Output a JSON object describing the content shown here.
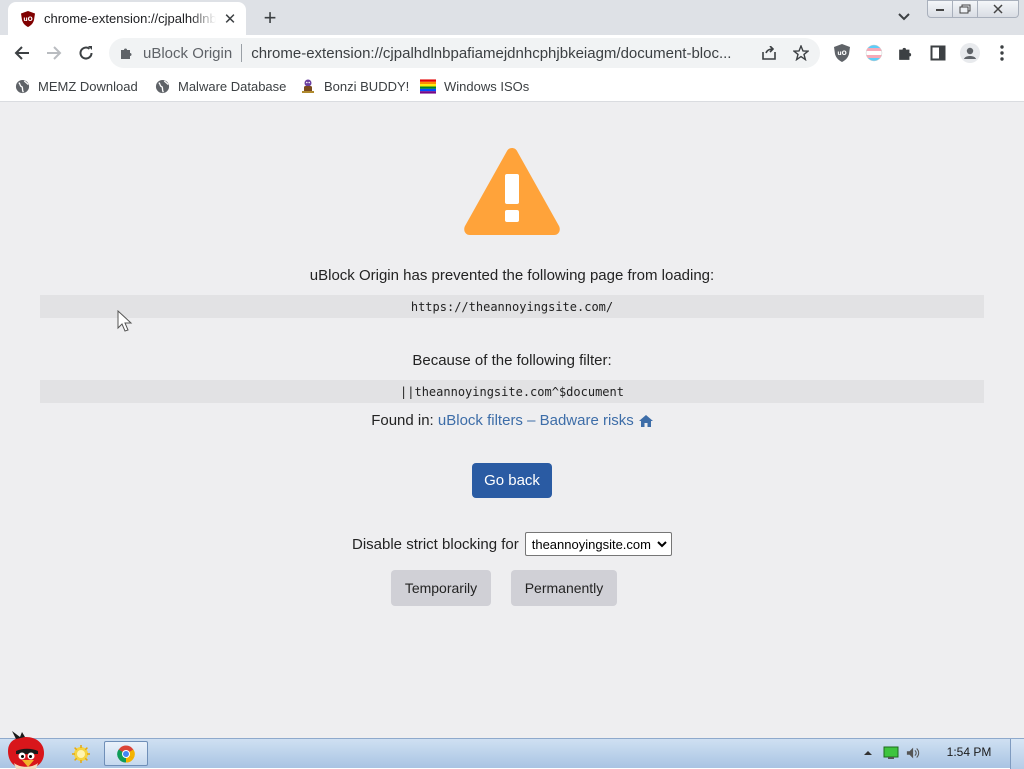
{
  "browser": {
    "tab": {
      "title": "chrome-extension://cjpalhdlnbpafiamejdnhcphjbkeiagm/document-blocked.html",
      "favicon": "ublock-origin-icon",
      "close_glyph": "✕"
    },
    "new_tab_glyph": "+",
    "omnibox": {
      "site_name": "uBlock Origin",
      "url": "chrome-extension://cjpalhdlnbpafiamejdnhcphjbkeiagm/document-bloc..."
    },
    "bookmarks": [
      {
        "label": "MEMZ Download",
        "icon": "globe-icon"
      },
      {
        "label": "Malware Database",
        "icon": "globe-icon"
      },
      {
        "label": "Bonzi BUDDY!",
        "icon": "bonzi-icon"
      },
      {
        "label": "Windows ISOs",
        "icon": "windows-flag-icon"
      }
    ]
  },
  "page": {
    "message": "uBlock Origin has prevented the following page from loading:",
    "blocked_url": "https://theannoyingsite.com/",
    "filter_message": "Because of the following filter:",
    "filter": "||theannoyingsite.com^$document",
    "found_in_label": "Found in:",
    "found_in_list": "uBlock filters – Badware risks",
    "go_back": "Go back",
    "strict_label": "Disable strict blocking for",
    "strict_domain": "theannoyingsite.com",
    "temporarily": "Temporarily",
    "permanently": "Permanently",
    "colors": {
      "warning": "#ffa33a",
      "primary_button": "#2a5ba3",
      "link": "#3d6da8",
      "background": "#eeeef0"
    }
  },
  "taskbar": {
    "clock": "1:54 PM"
  }
}
